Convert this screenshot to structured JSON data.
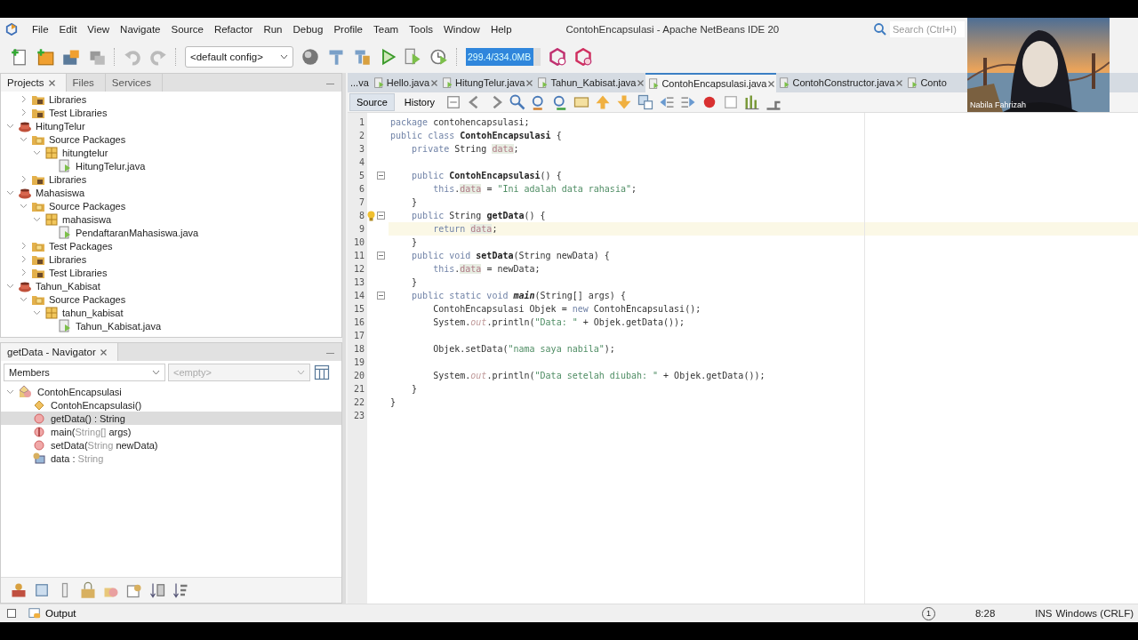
{
  "window": {
    "title": "ContohEncapsulasi - Apache NetBeans IDE 20"
  },
  "menu": [
    "File",
    "Edit",
    "View",
    "Navigate",
    "Source",
    "Refactor",
    "Run",
    "Debug",
    "Profile",
    "Team",
    "Tools",
    "Window",
    "Help"
  ],
  "search": {
    "placeholder": "Search (Ctrl+I)"
  },
  "toolbar": {
    "config": "<default config>",
    "memory": {
      "reading": "299.4/334.0MB",
      "level": 0.9
    }
  },
  "projects_panel": {
    "tabs": [
      {
        "label": "Projects",
        "selected": true,
        "closable": true
      },
      {
        "label": "Files",
        "selected": false,
        "closable": false
      },
      {
        "label": "Services",
        "selected": false,
        "closable": false
      }
    ],
    "tree": [
      {
        "kind": "cut",
        "children": [
          {
            "kind": "library",
            "label": "Libraries",
            "expanded": false
          },
          {
            "kind": "library",
            "label": "Test Libraries",
            "expanded": false
          }
        ]
      },
      {
        "kind": "project",
        "label": "HitungTelur",
        "expanded": true,
        "children": [
          {
            "kind": "source",
            "label": "Source Packages",
            "expanded": true,
            "children": [
              {
                "kind": "package",
                "label": "hitungtelur",
                "expanded": true,
                "children": [
                  {
                    "kind": "file",
                    "label": "HitungTelur.java"
                  }
                ]
              }
            ]
          },
          {
            "kind": "library",
            "label": "Libraries",
            "expanded": false
          }
        ]
      },
      {
        "kind": "project",
        "label": "Mahasiswa",
        "expanded": true,
        "children": [
          {
            "kind": "source",
            "label": "Source Packages",
            "expanded": true,
            "children": [
              {
                "kind": "package",
                "label": "mahasiswa",
                "expanded": true,
                "children": [
                  {
                    "kind": "file",
                    "label": "PendaftaranMahasiswa.java"
                  }
                ]
              }
            ]
          },
          {
            "kind": "source",
            "label": "Test Packages",
            "expanded": false
          },
          {
            "kind": "library",
            "label": "Libraries",
            "expanded": false
          },
          {
            "kind": "library",
            "label": "Test Libraries",
            "expanded": false
          }
        ]
      },
      {
        "kind": "project",
        "label": "Tahun_Kabisat",
        "expanded": true,
        "children": [
          {
            "kind": "source",
            "label": "Source Packages",
            "expanded": true,
            "children": [
              {
                "kind": "package",
                "label": "tahun_kabisat",
                "expanded": true,
                "children": [
                  {
                    "kind": "file",
                    "label": "Tahun_Kabisat.java"
                  }
                ]
              }
            ]
          }
        ]
      }
    ]
  },
  "navigator": {
    "title": "getData - Navigator",
    "closable": true,
    "filter": "Members",
    "filter2": {
      "value": "<empty>",
      "disabled": true
    },
    "members": [
      {
        "kind": "class",
        "parts": [
          {
            "text": "ContohEncapsulasi",
            "muted": false
          }
        ],
        "selected": false,
        "expanded": true,
        "children": [
          {
            "kind": "constructor",
            "parts": [
              {
                "text": "ContohEncapsulasi()",
                "muted": false
              }
            ],
            "selected": false
          },
          {
            "kind": "method",
            "parts": [
              {
                "text": "getData() : String",
                "muted": false
              }
            ],
            "selected": true
          },
          {
            "kind": "static-method",
            "parts": [
              {
                "text": "main(",
                "muted": false
              },
              {
                "text": "String[]",
                "muted": true
              },
              {
                "text": " args)",
                "muted": false
              }
            ],
            "selected": false
          },
          {
            "kind": "method",
            "parts": [
              {
                "text": "setData(",
                "muted": false
              },
              {
                "text": "String",
                "muted": true
              },
              {
                "text": " newData)",
                "muted": false
              }
            ],
            "selected": false
          },
          {
            "kind": "field",
            "parts": [
              {
                "text": "data : ",
                "muted": false
              },
              {
                "text": "String",
                "muted": true
              }
            ],
            "selected": false
          }
        ]
      }
    ]
  },
  "editor": {
    "tabs": [
      {
        "label": "...va",
        "selected": false,
        "closable": false,
        "icon": false
      },
      {
        "label": "Hello.java",
        "selected": false,
        "closable": true,
        "icon": true
      },
      {
        "label": "HitungTelur.java",
        "selected": false,
        "closable": true,
        "icon": true
      },
      {
        "label": "Tahun_Kabisat.java",
        "selected": false,
        "closable": true,
        "icon": true
      },
      {
        "label": "ContohEncapsulasi.java",
        "selected": true,
        "closable": true,
        "icon": true
      },
      {
        "label": "ContohConstructor.java",
        "selected": false,
        "closable": true,
        "icon": true
      },
      {
        "label": "Conto",
        "selected": false,
        "closable": false,
        "icon": true
      }
    ],
    "views": [
      {
        "label": "Source",
        "selected": true
      },
      {
        "label": "History",
        "selected": false
      }
    ],
    "lines": [
      {
        "number": "1",
        "tokens": [
          {
            "kind": "keyword",
            "text": "package"
          },
          {
            "kind": "plain",
            "text": " contohencapsulasi;"
          }
        ]
      },
      {
        "number": "2",
        "tokens": [
          {
            "kind": "keyword",
            "text": "public class "
          },
          {
            "kind": "bold",
            "text": "ContohEncapsulasi"
          },
          {
            "kind": "plain",
            "text": " {"
          }
        ]
      },
      {
        "number": "3",
        "tokens": [
          {
            "kind": "keyword",
            "text": "    private"
          },
          {
            "kind": "plain",
            "text": " String "
          },
          {
            "kind": "field",
            "text": "data"
          },
          {
            "kind": "plain",
            "text": ";"
          }
        ]
      },
      {
        "number": "4"
      },
      {
        "number": "5",
        "fold": true,
        "tokens": [
          {
            "kind": "keyword",
            "text": "    public "
          },
          {
            "kind": "bold",
            "text": "ContohEncapsulasi"
          },
          {
            "kind": "plain",
            "text": "() {"
          }
        ]
      },
      {
        "number": "6",
        "tokens": [
          {
            "kind": "keyword",
            "text": "        this"
          },
          {
            "kind": "plain",
            "text": "."
          },
          {
            "kind": "field",
            "text": "data"
          },
          {
            "kind": "plain",
            "text": " = "
          },
          {
            "kind": "string",
            "text": "\"Ini adalah data rahasia\""
          },
          {
            "kind": "plain",
            "text": ";"
          }
        ]
      },
      {
        "number": "7",
        "tokens": [
          {
            "kind": "plain",
            "text": "    }"
          }
        ]
      },
      {
        "number": "8",
        "fold": true,
        "hint": true,
        "tokens": [
          {
            "kind": "keyword",
            "text": "    public"
          },
          {
            "kind": "plain",
            "text": " String "
          },
          {
            "kind": "bold",
            "text": "getData"
          },
          {
            "kind": "plain",
            "text": "() {"
          }
        ]
      },
      {
        "number": "9",
        "current": true,
        "tokens": [
          {
            "kind": "keyword",
            "text": "        return "
          },
          {
            "kind": "field",
            "text": "data"
          },
          {
            "kind": "plain",
            "text": ";"
          }
        ]
      },
      {
        "number": "10",
        "tokens": [
          {
            "kind": "plain",
            "text": "    }"
          }
        ]
      },
      {
        "number": "11",
        "fold": true,
        "tokens": [
          {
            "kind": "keyword",
            "text": "    public void "
          },
          {
            "kind": "bold",
            "text": "setData"
          },
          {
            "kind": "plain",
            "text": "(String newData) {"
          }
        ]
      },
      {
        "number": "12",
        "tokens": [
          {
            "kind": "keyword",
            "text": "        this"
          },
          {
            "kind": "plain",
            "text": "."
          },
          {
            "kind": "field",
            "text": "data"
          },
          {
            "kind": "plain",
            "text": " = newData;"
          }
        ]
      },
      {
        "number": "13",
        "tokens": [
          {
            "kind": "plain",
            "text": "    }"
          }
        ]
      },
      {
        "number": "14",
        "fold": true,
        "tokens": [
          {
            "kind": "keyword",
            "text": "    public static void "
          },
          {
            "kind": "bold-italic",
            "text": "main"
          },
          {
            "kind": "plain",
            "text": "(String[] args) {"
          }
        ]
      },
      {
        "number": "15",
        "tokens": [
          {
            "kind": "plain",
            "text": "        ContohEncapsulasi Objek = "
          },
          {
            "kind": "keyword",
            "text": "new"
          },
          {
            "kind": "plain",
            "text": " ContohEncapsulasi();"
          }
        ]
      },
      {
        "number": "16",
        "tokens": [
          {
            "kind": "plain",
            "text": "        System."
          },
          {
            "kind": "static",
            "text": "out"
          },
          {
            "kind": "plain",
            "text": ".println("
          },
          {
            "kind": "string",
            "text": "\"Data: \""
          },
          {
            "kind": "plain",
            "text": " + Objek.getData());"
          }
        ]
      },
      {
        "number": "17"
      },
      {
        "number": "18",
        "tokens": [
          {
            "kind": "plain",
            "text": "        Objek.setData("
          },
          {
            "kind": "string",
            "text": "\"nama saya nabila\""
          },
          {
            "kind": "plain",
            "text": ");"
          }
        ]
      },
      {
        "number": "19"
      },
      {
        "number": "20",
        "tokens": [
          {
            "kind": "plain",
            "text": "        System."
          },
          {
            "kind": "static",
            "text": "out"
          },
          {
            "kind": "plain",
            "text": ".println("
          },
          {
            "kind": "string",
            "text": "\"Data setelah diubah: \""
          },
          {
            "kind": "plain",
            "text": " + Objek.getData());"
          }
        ]
      },
      {
        "number": "21",
        "tokens": [
          {
            "kind": "plain",
            "text": "    }"
          }
        ]
      },
      {
        "number": "22",
        "tokens": [
          {
            "kind": "plain",
            "text": "}"
          }
        ]
      },
      {
        "number": "23"
      }
    ]
  },
  "webcam": {
    "kind": "picture",
    "name": "Nabila Fahrizah"
  },
  "status_bar": {
    "output_tab": "Output",
    "notifications": "1",
    "position": "8:28",
    "mode": "INS",
    "line_endings": "Windows (CRLF)"
  }
}
